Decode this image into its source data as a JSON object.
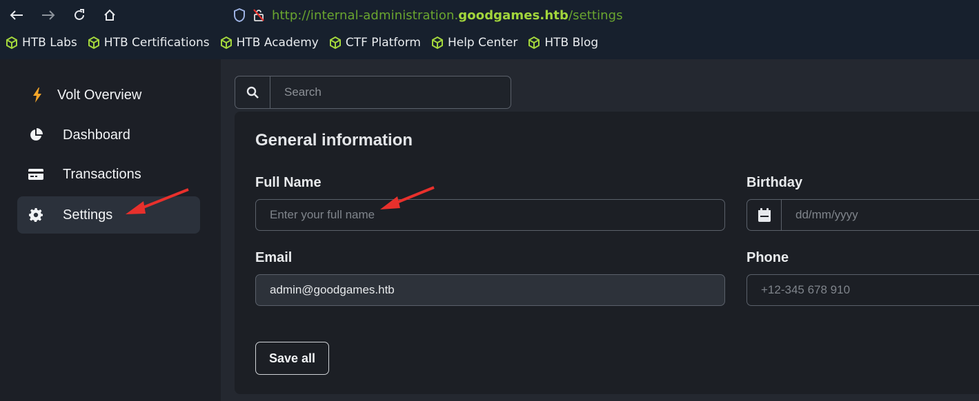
{
  "browser": {
    "url_prefix": "http://internal-administration.",
    "url_domain": "goodgames.htb",
    "url_path": "/settings",
    "bookmarks": [
      {
        "label": "HTB Labs"
      },
      {
        "label": "HTB Certifications"
      },
      {
        "label": "HTB Academy"
      },
      {
        "label": "CTF Platform"
      },
      {
        "label": "Help Center"
      },
      {
        "label": "HTB Blog"
      }
    ]
  },
  "sidebar": {
    "items": [
      {
        "label": "Volt Overview",
        "icon": "bolt-icon"
      },
      {
        "label": "Dashboard",
        "icon": "pie-chart-icon"
      },
      {
        "label": "Transactions",
        "icon": "credit-card-icon"
      },
      {
        "label": "Settings",
        "icon": "gear-icon",
        "active": true
      }
    ]
  },
  "search": {
    "placeholder": "Search"
  },
  "form": {
    "title": "General information",
    "full_name_label": "Full Name",
    "full_name_placeholder": "Enter your full name",
    "birthday_label": "Birthday",
    "birthday_placeholder": "dd/mm/yyyy",
    "email_label": "Email",
    "email_value": "admin@goodgames.htb",
    "phone_label": "Phone",
    "phone_placeholder": "+12-345 678 910",
    "save_label": "Save all"
  },
  "colors": {
    "accent_green": "#a3d63c",
    "annotation_red": "#e8302c"
  }
}
